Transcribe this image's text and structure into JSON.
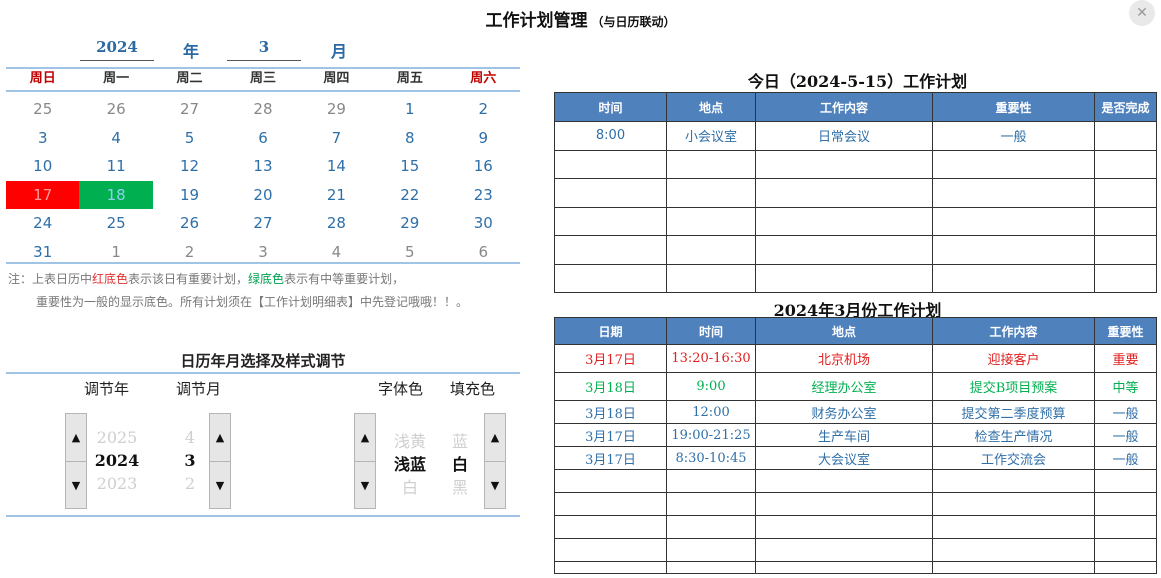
{
  "title": {
    "main": "工作计划管理",
    "sub": "（与日历联动）"
  },
  "calendar": {
    "year": "2024",
    "year_label": "年",
    "month": "3",
    "month_label": "月",
    "weekdays": [
      "周日",
      "周一",
      "周二",
      "周三",
      "周四",
      "周五",
      "周六"
    ],
    "weeks": [
      [
        "25",
        "26",
        "27",
        "28",
        "29",
        "1",
        "2"
      ],
      [
        "3",
        "4",
        "5",
        "6",
        "7",
        "8",
        "9"
      ],
      [
        "10",
        "11",
        "12",
        "13",
        "14",
        "15",
        "16"
      ],
      [
        "17",
        "18",
        "19",
        "20",
        "21",
        "22",
        "23"
      ],
      [
        "24",
        "25",
        "26",
        "27",
        "28",
        "29",
        "30"
      ],
      [
        "31",
        "1",
        "2",
        "3",
        "4",
        "5",
        "6"
      ]
    ],
    "highlight_colors": {
      "important": "#ff0000",
      "medium": "#00b050"
    }
  },
  "note": {
    "prefix": "注：上表日历中",
    "red": "红底色",
    "mid1": "表示该日有重要计划，",
    "green": "绿底色",
    "mid2": "表示有中等重要计划，",
    "line2": "重要性为一般的显示底色。所有计划须在【工作计划明细表】中先登记哦哦！！。"
  },
  "adjust": {
    "title": "日历年月选择及样式调节",
    "labels": {
      "year": "调节年",
      "month": "调节月",
      "font_color": "字体色",
      "fill_color": "填充色"
    },
    "year": {
      "prev": "2025",
      "current": "2024",
      "next": "2023"
    },
    "month": {
      "prev": "4",
      "current": "3",
      "next": "2"
    },
    "font_color": {
      "prev": "浅黄",
      "current": "浅蓝",
      "next": "白"
    },
    "fill_color": {
      "prev": "蓝",
      "current": "白",
      "next": "黑"
    },
    "up_icon": "▲",
    "down_icon": "▼"
  },
  "today": {
    "title": "今日（2024-5-15）工作计划",
    "headers": [
      "时间",
      "地点",
      "工作内容",
      "重要性",
      "是否完成"
    ],
    "rows": [
      [
        "8:00",
        "小会议室",
        "日常会议",
        "一般",
        ""
      ]
    ],
    "empty_rows": 5
  },
  "monthly": {
    "title": "2024年3月份工作计划",
    "headers": [
      "日期",
      "时间",
      "地点",
      "工作内容",
      "重要性"
    ],
    "rows": [
      {
        "cells": [
          "3月17日",
          "13:20-16:30",
          "北京机场",
          "迎接客户",
          "重要"
        ],
        "color": "#e02020"
      },
      {
        "cells": [
          "3月18日",
          "9:00",
          "经理办公室",
          "提交B项目预案",
          "中等"
        ],
        "color": "#00b050"
      },
      {
        "cells": [
          "3月18日",
          "12:00",
          "财务办公室",
          "提交第二季度预算",
          "一般"
        ],
        "color": "#2f6fa8"
      },
      {
        "cells": [
          "3月17日",
          "19:00-21:25",
          "生产车间",
          "检查生产情况",
          "一般"
        ],
        "color": "#2f6fa8"
      },
      {
        "cells": [
          "3月17日",
          "8:30-10:45",
          "大会议室",
          "工作交流会",
          "一般"
        ],
        "color": "#2f6fa8"
      }
    ],
    "empty_rows": 5
  }
}
